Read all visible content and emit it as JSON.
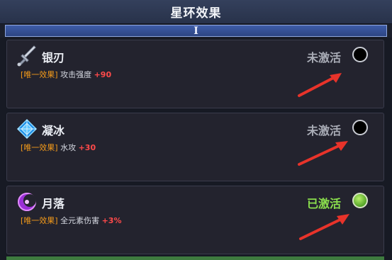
{
  "header": {
    "title": "星环效果"
  },
  "tab": {
    "label": "I"
  },
  "cards": [
    {
      "name": "银刃",
      "effect_tag": "[唯一效果]",
      "effect_text": "攻击强度",
      "effect_bonus": "+90",
      "status": "未激活",
      "active": false,
      "icon": "silver-blade-icon"
    },
    {
      "name": "凝冰",
      "effect_tag": "[唯一效果]",
      "effect_text": "水攻",
      "effect_bonus": "+30",
      "status": "未激活",
      "active": false,
      "icon": "ice-crystal-icon"
    },
    {
      "name": "月落",
      "effect_tag": "[唯一效果]",
      "effect_text": "全元素伤害",
      "effect_bonus": "+3%",
      "status": "已激活",
      "active": true,
      "icon": "moon-fall-icon"
    }
  ],
  "colors": {
    "inactive": "#a9acb6",
    "active": "#8be04d",
    "tag": "#f39a1a",
    "bonus": "#ff4a4a",
    "arrow": "#e8332a"
  }
}
